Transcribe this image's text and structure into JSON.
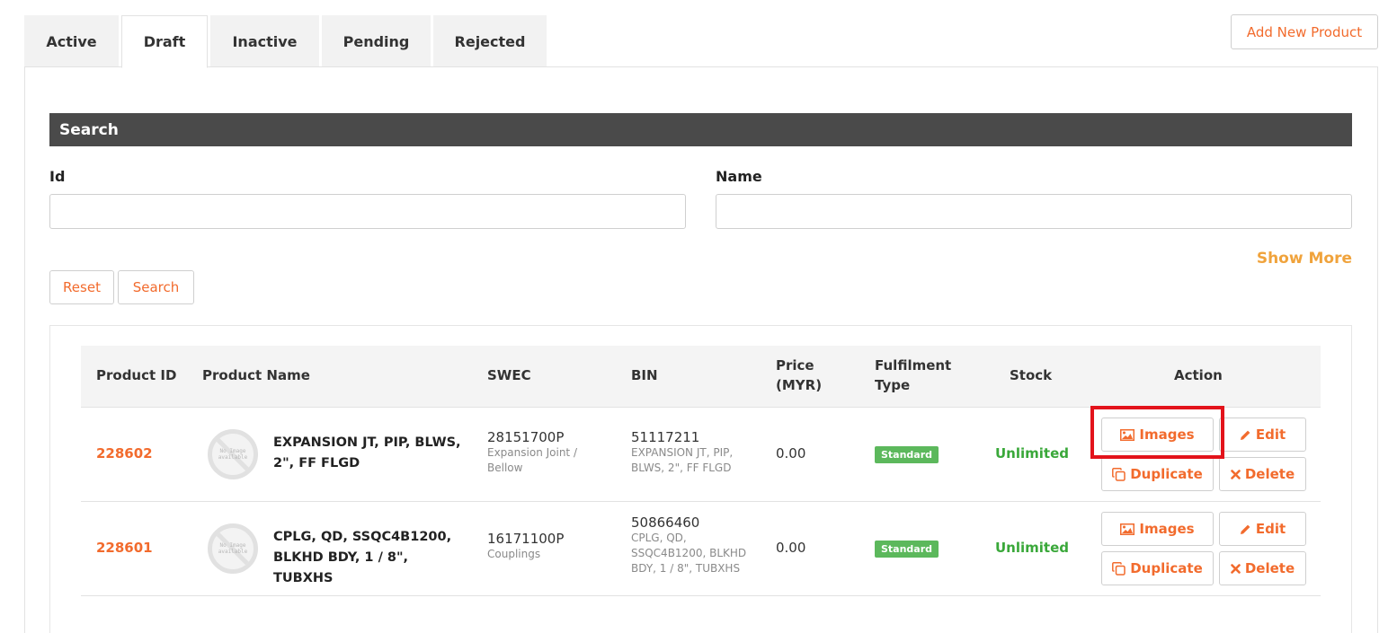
{
  "tabs": [
    "Active",
    "Draft",
    "Inactive",
    "Pending",
    "Rejected"
  ],
  "active_tab": "Draft",
  "add_button": "Add New Product",
  "search": {
    "title": "Search",
    "id_label": "Id",
    "name_label": "Name",
    "id_value": "",
    "name_value": "",
    "show_more": "Show More",
    "reset": "Reset",
    "search": "Search"
  },
  "table": {
    "headers": {
      "product_id": "Product ID",
      "product_name": "Product Name",
      "swec": "SWEC",
      "bin": "BIN",
      "price_line1": "Price",
      "price_line2": "(MYR)",
      "fulfilment_line1": "Fulfilment",
      "fulfilment_line2": "Type",
      "stock": "Stock",
      "action": "Action"
    },
    "no_image_text": "No Image available",
    "rows": [
      {
        "id": "228602",
        "name": "EXPANSION JT, PIP, BLWS, 2\", FF FLGD",
        "swec_code": "28151700P",
        "swec_desc": "Expansion Joint / Bellow",
        "bin_code": "51117211",
        "bin_desc": "EXPANSION JT, PIP, BLWS, 2\", FF FLGD",
        "price": "0.00",
        "fulfilment": "Standard",
        "stock": "Unlimited"
      },
      {
        "id": "228601",
        "name": "CPLG, QD, SSQC4B1200, BLKHD BDY, 1 / 8\", TUBXHS",
        "swec_code": "16171100P",
        "swec_desc": "Couplings",
        "bin_code": "50866460",
        "bin_desc": "CPLG, QD, SSQC4B1200, BLKHD BDY, 1 / 8\", TUBXHS",
        "price": "0.00",
        "fulfilment": "Standard",
        "stock": "Unlimited"
      }
    ],
    "actions": {
      "images": "Images",
      "edit": "Edit",
      "duplicate": "Duplicate",
      "delete": "Delete"
    }
  },
  "colors": {
    "accent": "#f26b2d",
    "show_more": "#f0a33c",
    "header_bar": "#4a4a4a",
    "stock": "#3aa83a",
    "badge": "#5cb85c",
    "highlight": "#e3131b"
  },
  "icons": [
    "image-icon",
    "pencil-icon",
    "copy-icon",
    "times-icon"
  ]
}
